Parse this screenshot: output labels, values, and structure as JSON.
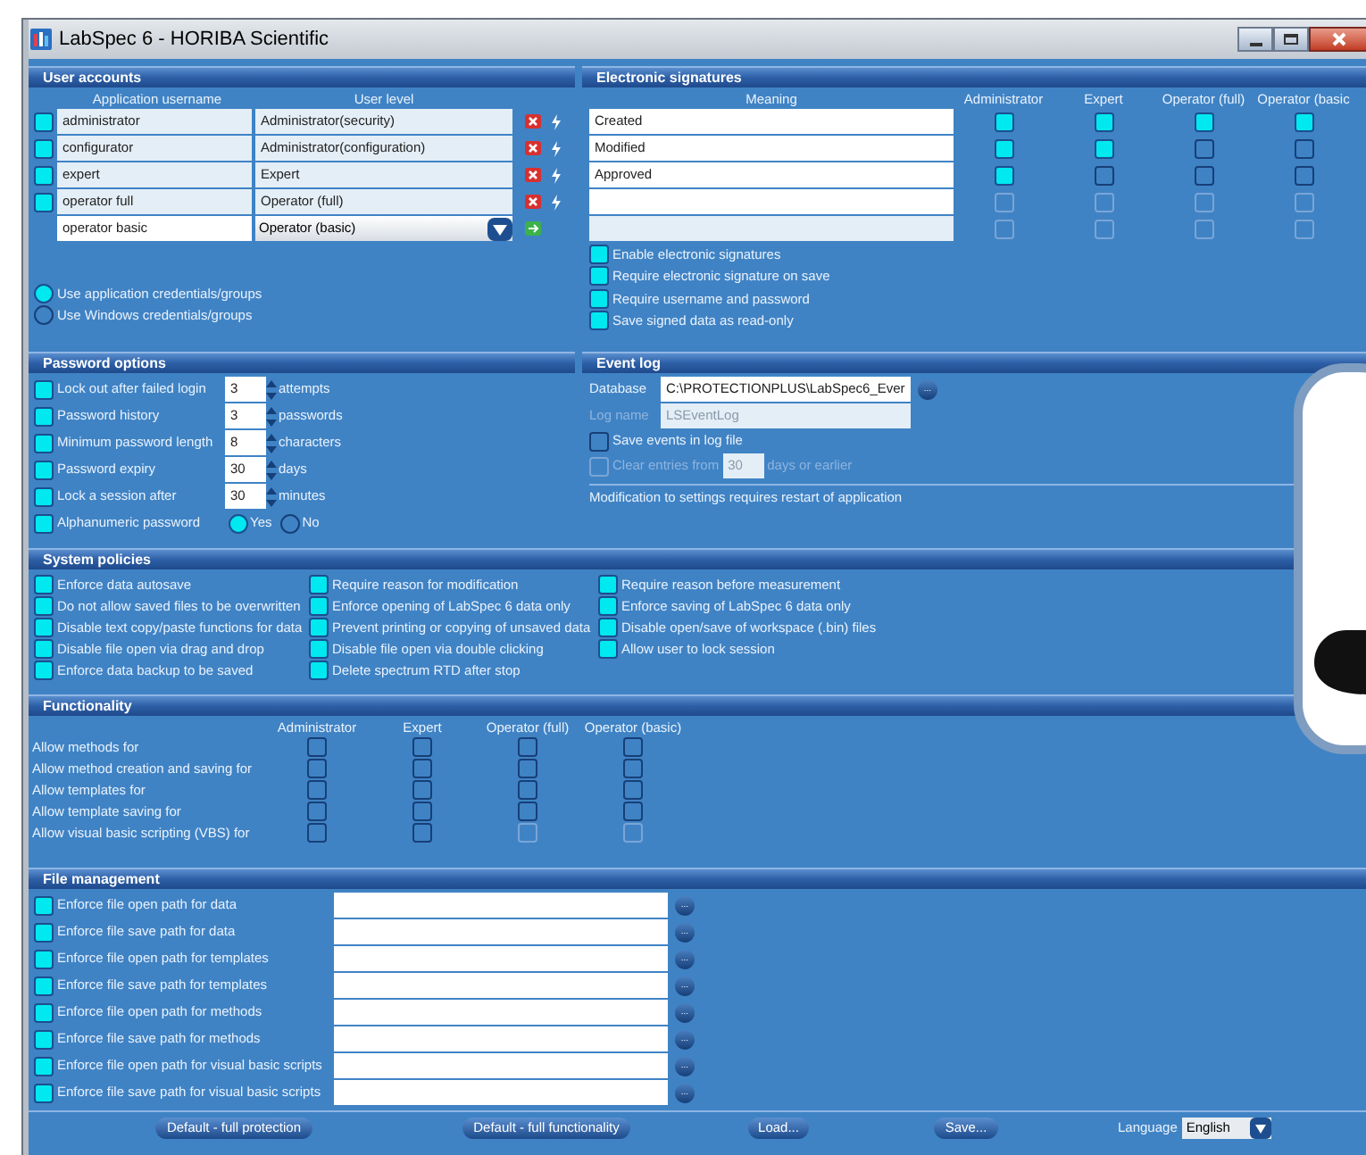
{
  "window": {
    "title": "LabSpec 6 - HORIBA Scientific"
  },
  "user_accounts": {
    "title": "User accounts",
    "columns": [
      "Application username",
      "User level"
    ],
    "users": [
      {
        "kind": "existing",
        "checked": true,
        "username": "administrator",
        "level": "Administrator(security)"
      },
      {
        "kind": "existing",
        "checked": true,
        "username": "configurator",
        "level": "Administrator(configuration)"
      },
      {
        "kind": "existing",
        "checked": true,
        "username": "expert",
        "level": "Expert"
      },
      {
        "kind": "existing",
        "checked": true,
        "username": "operator full",
        "level": "Operator (full)"
      },
      {
        "kind": "new",
        "username": "operator basic",
        "level": "Operator (basic)"
      }
    ],
    "credentials": [
      {
        "label": "Use application credentials/groups",
        "selected": true
      },
      {
        "label": "Use Windows credentials/groups",
        "selected": false
      }
    ]
  },
  "electronic_signatures": {
    "title": "Electronic signatures",
    "meaning_label": "Meaning",
    "roles": [
      "Administrator",
      "Expert",
      "Operator (full)",
      "Operator (basic"
    ],
    "rows": [
      {
        "meaning": "Created",
        "field_disabled": false,
        "disabled": false,
        "checks": [
          true,
          true,
          true,
          true
        ]
      },
      {
        "meaning": "Modified",
        "field_disabled": false,
        "disabled": false,
        "checks": [
          true,
          true,
          false,
          false
        ]
      },
      {
        "meaning": "Approved",
        "field_disabled": false,
        "disabled": false,
        "checks": [
          true,
          false,
          false,
          false
        ]
      },
      {
        "field_disabled": false,
        "disabled": true,
        "checks": [
          false,
          false,
          false,
          false
        ]
      },
      {
        "field_disabled": true,
        "disabled": true,
        "checks": [
          false,
          false,
          false,
          false
        ]
      }
    ],
    "options": [
      {
        "label": "Enable electronic signatures",
        "checked": true
      },
      {
        "label": "Require electronic signature on save",
        "checked": true
      },
      {
        "label": "Require username and password",
        "checked": true
      },
      {
        "label": "Save signed data as read-only",
        "checked": true
      }
    ]
  },
  "password_options": {
    "title": "Password options",
    "rows": [
      {
        "label": "Lock out after failed login",
        "checked": true,
        "value": "3",
        "unit": "attempts"
      },
      {
        "label": "Password history",
        "checked": true,
        "value": "3",
        "unit": "passwords"
      },
      {
        "label": "Minimum password length",
        "checked": true,
        "value": "8",
        "unit": "characters"
      },
      {
        "label": "Password expiry",
        "checked": true,
        "value": "30",
        "unit": "days"
      },
      {
        "label": "Lock a session after",
        "checked": true,
        "value": "30",
        "unit": "minutes"
      }
    ],
    "alphanumeric": {
      "label": "Alphanumeric password",
      "checked": true,
      "options": [
        {
          "label": "Yes",
          "selected": true
        },
        {
          "label": "No",
          "selected": false
        }
      ]
    }
  },
  "event_log": {
    "title": "Event log",
    "database": {
      "label": "Database",
      "value": "C:\\PROTECTIONPLUS\\LabSpec6_Ever",
      "button": "..."
    },
    "log_name": {
      "label": "Log name",
      "value": "LSEventLog",
      "disabled": true
    },
    "save_events": {
      "label": "Save events in log file",
      "checked": false
    },
    "clear_entries": {
      "label": "Clear entries from",
      "value": "30",
      "suffix": "days or earlier",
      "checked": false,
      "disabled": true
    },
    "note": "Modification to settings requires restart of application"
  },
  "system_policies": {
    "title": "System policies",
    "columns": [
      [
        {
          "label": "Enforce data autosave",
          "checked": true
        },
        {
          "label": "Do not allow saved files to be overwritten",
          "checked": true
        },
        {
          "label": "Disable text copy/paste functions for data",
          "checked": true
        },
        {
          "label": "Disable file open via drag and drop",
          "checked": true
        },
        {
          "label": "Enforce data backup to be saved",
          "checked": true
        }
      ],
      [
        {
          "label": "Require reason for modification",
          "checked": true
        },
        {
          "label": "Enforce opening of LabSpec 6 data only",
          "checked": true
        },
        {
          "label": "Prevent printing or copying of unsaved data",
          "checked": true
        },
        {
          "label": "Disable file open via double clicking",
          "checked": true
        },
        {
          "label": "Delete spectrum RTD after stop",
          "checked": true
        }
      ],
      [
        {
          "label": "Require reason before measurement",
          "checked": true
        },
        {
          "label": "Enforce saving of LabSpec 6 data only",
          "checked": true
        },
        {
          "label": "Disable open/save of workspace (.bin) files",
          "checked": true
        },
        {
          "label": "Allow user to lock session",
          "checked": true
        }
      ]
    ]
  },
  "functionality": {
    "title": "Functionality",
    "roles": [
      "Administrator",
      "Expert",
      "Operator (full)",
      "Operator (basic)"
    ],
    "rows": [
      {
        "label": "Allow methods for",
        "cells": [
          {
            "checked": false,
            "disabled": false
          },
          {
            "checked": false,
            "disabled": false
          },
          {
            "checked": false,
            "disabled": false
          },
          {
            "checked": false,
            "disabled": false
          }
        ]
      },
      {
        "label": "Allow method creation and saving for",
        "cells": [
          {
            "checked": false,
            "disabled": false
          },
          {
            "checked": false,
            "disabled": false
          },
          {
            "checked": false,
            "disabled": false
          },
          {
            "checked": false,
            "disabled": false
          }
        ]
      },
      {
        "label": "Allow templates for",
        "cells": [
          {
            "checked": false,
            "disabled": false
          },
          {
            "checked": false,
            "disabled": false
          },
          {
            "checked": false,
            "disabled": false
          },
          {
            "checked": false,
            "disabled": false
          }
        ]
      },
      {
        "label": "Allow template saving for",
        "cells": [
          {
            "checked": false,
            "disabled": false
          },
          {
            "checked": false,
            "disabled": false
          },
          {
            "checked": false,
            "disabled": false
          },
          {
            "checked": false,
            "disabled": false
          }
        ]
      },
      {
        "label": "Allow visual basic scripting (VBS) for",
        "cells": [
          {
            "checked": false,
            "disabled": false
          },
          {
            "checked": false,
            "disabled": false
          },
          {
            "checked": false,
            "disabled": true
          },
          {
            "checked": false,
            "disabled": true
          }
        ]
      }
    ]
  },
  "file_management": {
    "title": "File management",
    "browse_button": "...",
    "rows": [
      {
        "label": "Enforce file open path for data",
        "checked": true
      },
      {
        "label": "Enforce file save path for data",
        "checked": true
      },
      {
        "label": "Enforce file open path for templates",
        "checked": true
      },
      {
        "label": "Enforce file save path for templates",
        "checked": true
      },
      {
        "label": "Enforce file open path for methods",
        "checked": true
      },
      {
        "label": "Enforce file save path for methods",
        "checked": true
      },
      {
        "label": "Enforce file open path for visual basic scripts",
        "checked": true
      },
      {
        "label": "Enforce file save path for visual basic scripts",
        "checked": true
      }
    ]
  },
  "buttons": [
    "Default - full protection",
    "Default - full functionality",
    "Load...",
    "Save..."
  ],
  "language": {
    "label": "Language",
    "value": "English"
  }
}
